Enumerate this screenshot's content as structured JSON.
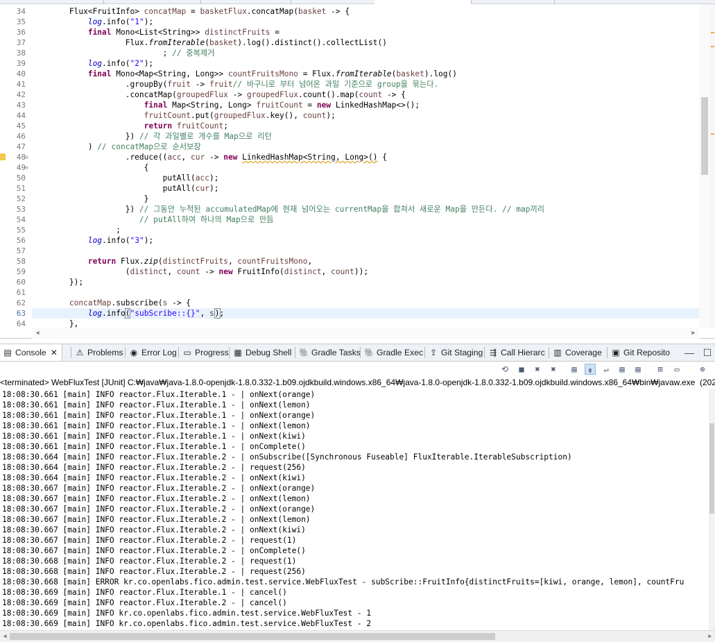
{
  "editor": {
    "lines": [
      {
        "no": "34",
        "tokens": [
          [
            "",
            "        "
          ],
          [
            "",
            "Flux<FruitInfo> "
          ],
          [
            "var",
            "concatMap"
          ],
          [
            "",
            " = "
          ],
          [
            "var",
            "basketFlux"
          ],
          [
            "",
            ".concatMap("
          ],
          [
            "var",
            "basket"
          ],
          [
            "",
            " -> {"
          ]
        ]
      },
      {
        "no": "35",
        "tokens": [
          [
            "",
            "            "
          ],
          [
            "fld",
            "log"
          ],
          [
            "",
            ".info("
          ],
          [
            "str",
            "\"1\""
          ],
          [
            "",
            ");"
          ]
        ]
      },
      {
        "no": "36",
        "tokens": [
          [
            "",
            "            "
          ],
          [
            "kw",
            "final"
          ],
          [
            "",
            " Mono<List<String>> "
          ],
          [
            "var",
            "distinctFruits"
          ],
          [
            "",
            " ="
          ]
        ]
      },
      {
        "no": "37",
        "tokens": [
          [
            "",
            "                    Flux."
          ],
          [
            "it",
            "fromIterable"
          ],
          [
            "",
            "("
          ],
          [
            "var",
            "basket"
          ],
          [
            "",
            ").log().distinct().collectList()"
          ]
        ]
      },
      {
        "no": "38",
        "tokens": [
          [
            "",
            "                            ; "
          ],
          [
            "cm",
            "// 중복제거"
          ]
        ]
      },
      {
        "no": "39",
        "tokens": [
          [
            "",
            "            "
          ],
          [
            "fld",
            "log"
          ],
          [
            "",
            ".info("
          ],
          [
            "str",
            "\"2\""
          ],
          [
            "",
            ");"
          ]
        ]
      },
      {
        "no": "40",
        "tokens": [
          [
            "",
            "            "
          ],
          [
            "kw",
            "final"
          ],
          [
            "",
            " Mono<Map<String, Long>> "
          ],
          [
            "var",
            "countFruitsMono"
          ],
          [
            "",
            " = Flux."
          ],
          [
            "it",
            "fromIterable"
          ],
          [
            "",
            "("
          ],
          [
            "var",
            "basket"
          ],
          [
            "",
            ").log()"
          ]
        ]
      },
      {
        "no": "41",
        "tokens": [
          [
            "",
            "                    .groupBy("
          ],
          [
            "var",
            "fruit"
          ],
          [
            "",
            " -> "
          ],
          [
            "var",
            "fruit"
          ],
          [
            ") "
          ],
          [
            "cm",
            "// 바구니로 부터 넘어온 과일 기준으로 group을 묶는다."
          ]
        ]
      },
      {
        "no": "42",
        "tokens": [
          [
            "",
            "                    .concatMap("
          ],
          [
            "var",
            "groupedFlux"
          ],
          [
            "",
            " -> "
          ],
          [
            "var",
            "groupedFlux"
          ],
          [
            "",
            ".count().map("
          ],
          [
            "var",
            "count"
          ],
          [
            "",
            " -> {"
          ]
        ]
      },
      {
        "no": "43",
        "tokens": [
          [
            "",
            "                        "
          ],
          [
            "kw",
            "final"
          ],
          [
            "",
            " Map<String, Long> "
          ],
          [
            "var",
            "fruitCount"
          ],
          [
            "",
            " = "
          ],
          [
            "kw",
            "new"
          ],
          [
            "",
            " LinkedHashMap<>();"
          ]
        ]
      },
      {
        "no": "44",
        "tokens": [
          [
            "",
            "                        "
          ],
          [
            "var",
            "fruitCount"
          ],
          [
            "",
            ".put("
          ],
          [
            "var",
            "groupedFlux"
          ],
          [
            "",
            ".key(), "
          ],
          [
            "var",
            "count"
          ],
          [
            "",
            ");"
          ]
        ]
      },
      {
        "no": "45",
        "tokens": [
          [
            "",
            "                        "
          ],
          [
            "kw",
            "return"
          ],
          [
            "",
            " "
          ],
          [
            "var",
            "fruitCount"
          ],
          [
            "",
            ";"
          ]
        ]
      },
      {
        "no": "46",
        "tokens": [
          [
            "",
            "                    }) "
          ],
          [
            "cm",
            "// 각 과일별로 개수를 Map으로 리턴"
          ]
        ]
      },
      {
        "no": "47",
        "tokens": [
          [
            "",
            "            ) "
          ],
          [
            "cm",
            "// concatMap으로 순서보장"
          ]
        ]
      },
      {
        "no": "48",
        "tokens": [
          [
            "",
            "                    .reduce(("
          ],
          [
            "var",
            "acc"
          ],
          [
            "",
            ", "
          ],
          [
            "var",
            "cur"
          ],
          [
            "",
            " -> "
          ],
          [
            "kw",
            "new"
          ],
          [
            "",
            " "
          ],
          [
            "warnu",
            "LinkedHashMap<String, Long>()"
          ],
          [
            "",
            " {"
          ]
        ]
      },
      {
        "no": "49",
        "tokens": [
          [
            "",
            "                        {"
          ]
        ]
      },
      {
        "no": "50",
        "tokens": [
          [
            "",
            "                            putAll("
          ],
          [
            "var",
            "acc"
          ],
          [
            "",
            ");"
          ]
        ]
      },
      {
        "no": "51",
        "tokens": [
          [
            "",
            "                            putAll("
          ],
          [
            "var",
            "cur"
          ],
          [
            "",
            ");"
          ]
        ]
      },
      {
        "no": "52",
        "tokens": [
          [
            "",
            "                        }"
          ]
        ]
      },
      {
        "no": "53",
        "tokens": [
          [
            "",
            "                    }) "
          ],
          [
            "cm",
            "// 그동안 누적된 accumulatedMap에 현재 넘어오는 currentMap을 합쳐서 새로운 Map을 만든다. // map끼리"
          ]
        ]
      },
      {
        "no": "54",
        "tokens": [
          [
            "",
            "                       "
          ],
          [
            "cm",
            "// putAll하여 하나의 Map으로 만듬"
          ]
        ]
      },
      {
        "no": "55",
        "tokens": [
          [
            "",
            "                  ;"
          ]
        ]
      },
      {
        "no": "56",
        "tokens": [
          [
            "",
            "            "
          ],
          [
            "fld",
            "log"
          ],
          [
            "",
            ".info("
          ],
          [
            "str",
            "\"3\""
          ],
          [
            "",
            ");"
          ]
        ]
      },
      {
        "no": "57",
        "tokens": [
          [
            "",
            ""
          ]
        ]
      },
      {
        "no": "58",
        "tokens": [
          [
            "",
            "            "
          ],
          [
            "kw",
            "return"
          ],
          [
            "",
            " Flux."
          ],
          [
            "it",
            "zip"
          ],
          [
            "",
            "("
          ],
          [
            "var",
            "distinctFruits"
          ],
          [
            "",
            ", "
          ],
          [
            "var",
            "countFruitsMono"
          ],
          [
            "",
            ","
          ]
        ]
      },
      {
        "no": "59",
        "tokens": [
          [
            "",
            "                    ("
          ],
          [
            "var",
            "distinct"
          ],
          [
            "",
            ", "
          ],
          [
            "var",
            "count"
          ],
          [
            "",
            " -> "
          ],
          [
            "kw",
            "new"
          ],
          [
            "",
            " FruitInfo("
          ],
          [
            "var",
            "distinct"
          ],
          [
            "",
            ", "
          ],
          [
            "var",
            "count"
          ],
          [
            "",
            "));"
          ]
        ]
      },
      {
        "no": "60",
        "tokens": [
          [
            "",
            "        });"
          ]
        ]
      },
      {
        "no": "61",
        "tokens": [
          [
            "",
            ""
          ]
        ]
      },
      {
        "no": "62",
        "tokens": [
          [
            "",
            "        "
          ],
          [
            "var",
            "concatMap"
          ],
          [
            "",
            ".subscribe("
          ],
          [
            "var",
            "s"
          ],
          [
            "",
            " -> {"
          ]
        ]
      },
      {
        "no": "63",
        "tokens": [
          [
            "",
            "            "
          ],
          [
            "fld",
            "log"
          ],
          [
            "",
            ".info"
          ],
          [
            "brk",
            "("
          ],
          [
            "str",
            "\"subScribe::{}\""
          ],
          [
            "",
            ", "
          ],
          [
            "var",
            "s"
          ],
          [
            "caret",
            ""
          ],
          [
            "brk",
            ")"
          ],
          [
            "",
            ";"
          ]
        ]
      },
      {
        "no": "64",
        "tokens": [
          [
            "",
            "        },"
          ]
        ]
      }
    ]
  },
  "console_tabs": [
    {
      "label": "Console",
      "icon": "console-icon",
      "glyph": "▤",
      "close": "✕",
      "active": true
    },
    {
      "label": "Problems",
      "icon": "problems-icon",
      "glyph": "⚠"
    },
    {
      "label": "Error Log",
      "icon": "error-log-icon",
      "glyph": "◉"
    },
    {
      "label": "Progress",
      "icon": "progress-icon",
      "glyph": "▭"
    },
    {
      "label": "Debug Shell",
      "icon": "debug-shell-icon",
      "glyph": "▦"
    },
    {
      "label": "Gradle Tasks",
      "icon": "gradle-tasks-icon",
      "glyph": "🐘"
    },
    {
      "label": "Gradle Exec",
      "icon": "gradle-exec-icon",
      "glyph": "🐘"
    },
    {
      "label": "Git Staging",
      "icon": "git-staging-icon",
      "glyph": "⇪"
    },
    {
      "label": "Call Hierarc",
      "icon": "call-hierarchy-icon",
      "glyph": "⇶"
    },
    {
      "label": "Coverage",
      "icon": "coverage-icon",
      "glyph": "▥"
    },
    {
      "label": "Git Reposito",
      "icon": "git-repository-icon",
      "glyph": "▣"
    }
  ],
  "console": {
    "status": "<terminated> WebFluxTest [JUnit] C:₩java₩java-1.8.0-openjdk-1.8.0.332-1.b09.ojdkbuild.windows.x86_64₩java-1.8.0-openjdk-1.8.0.332-1.b09.ojdkbuild.windows.x86_64₩bin₩javaw.exe  (2022",
    "lines": [
      "18:08:30.661 [main] INFO reactor.Flux.Iterable.1 - | onNext(orange)",
      "18:08:30.661 [main] INFO reactor.Flux.Iterable.1 - | onNext(lemon)",
      "18:08:30.661 [main] INFO reactor.Flux.Iterable.1 - | onNext(orange)",
      "18:08:30.661 [main] INFO reactor.Flux.Iterable.1 - | onNext(lemon)",
      "18:08:30.661 [main] INFO reactor.Flux.Iterable.1 - | onNext(kiwi)",
      "18:08:30.661 [main] INFO reactor.Flux.Iterable.1 - | onComplete()",
      "18:08:30.664 [main] INFO reactor.Flux.Iterable.2 - | onSubscribe([Synchronous Fuseable] FluxIterable.IterableSubscription)",
      "18:08:30.664 [main] INFO reactor.Flux.Iterable.2 - | request(256)",
      "18:08:30.664 [main] INFO reactor.Flux.Iterable.2 - | onNext(kiwi)",
      "18:08:30.667 [main] INFO reactor.Flux.Iterable.2 - | onNext(orange)",
      "18:08:30.667 [main] INFO reactor.Flux.Iterable.2 - | onNext(lemon)",
      "18:08:30.667 [main] INFO reactor.Flux.Iterable.2 - | onNext(orange)",
      "18:08:30.667 [main] INFO reactor.Flux.Iterable.2 - | onNext(lemon)",
      "18:08:30.667 [main] INFO reactor.Flux.Iterable.2 - | onNext(kiwi)",
      "18:08:30.667 [main] INFO reactor.Flux.Iterable.2 - | request(1)",
      "18:08:30.667 [main] INFO reactor.Flux.Iterable.2 - | onComplete()",
      "18:08:30.668 [main] INFO reactor.Flux.Iterable.2 - | request(1)",
      "18:08:30.668 [main] INFO reactor.Flux.Iterable.2 - | request(256)",
      "18:08:30.668 [main] ERROR kr.co.openlabs.fico.admin.test.service.WebFluxTest - subScribe::FruitInfo{distinctFruits=[kiwi, orange, lemon], countFru",
      "18:08:30.669 [main] INFO reactor.Flux.Iterable.1 - | cancel()",
      "18:08:30.669 [main] INFO reactor.Flux.Iterable.2 - | cancel()",
      "18:08:30.669 [main] INFO kr.co.openlabs.fico.admin.test.service.WebFluxTest - 1",
      "18:08:30.669 [main] INFO kr.co.openlabs.fico.admin.test.service.WebFluxTest - 2"
    ]
  },
  "toolbar_icons": [
    "relaunch-icon",
    "terminate-icon",
    "remove-launch-icon",
    "remove-all-icon",
    "clear-console-icon",
    "scroll-lock-icon",
    "word-wrap-icon",
    "show-on-output-icon",
    "show-on-error-icon",
    "pin-console-icon",
    "display-console-icon",
    "open-console-icon"
  ],
  "colors": {
    "keyword": "#7f0055",
    "string": "#2a00ff",
    "comment": "#3f7f5f",
    "field": "#0000c0",
    "current_line": "#e8f2fe"
  }
}
